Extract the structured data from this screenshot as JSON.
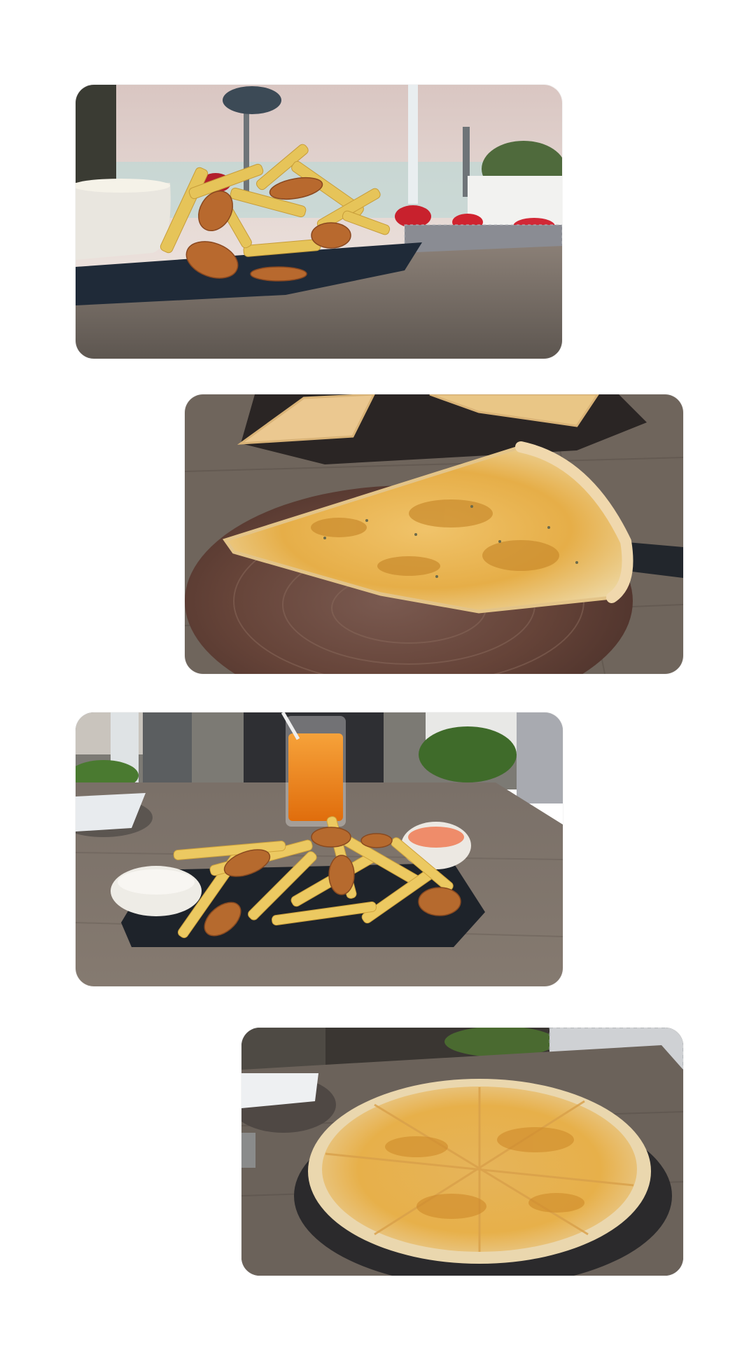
{
  "gallery": {
    "photos": [
      {
        "subject": "fries-platter-outdoor-terrace",
        "icon": "photo-fries-sunset"
      },
      {
        "subject": "cheese-pizza-slice-on-brown-plate",
        "icon": "photo-pizza-slice"
      },
      {
        "subject": "fries-platter-with-orange-juice",
        "icon": "photo-fries-juice"
      },
      {
        "subject": "whole-cheese-pizza-on-board",
        "icon": "photo-whole-pizza"
      }
    ]
  },
  "colors": {
    "background": "#ffffff",
    "fries": "#e8c45a",
    "cheese": "#e2a63a",
    "table": "#6e6459",
    "plate_dark": "#1f2630",
    "plate_brown": "#6a4a40",
    "juice": "#f08a1a",
    "sky": "#e8d9d2"
  }
}
